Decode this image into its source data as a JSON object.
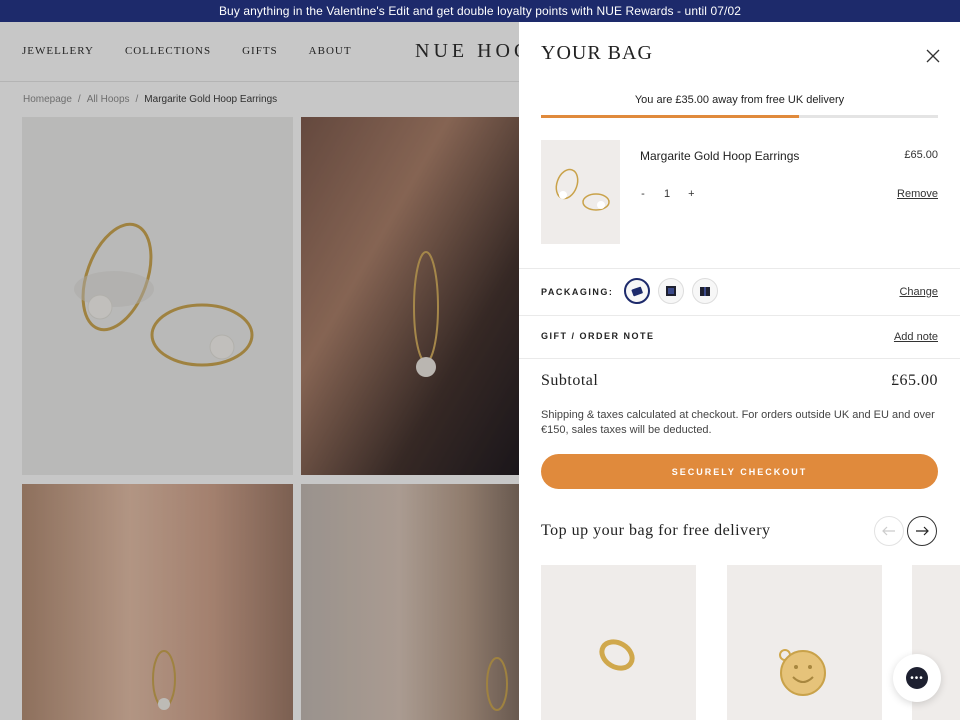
{
  "announcement": "Buy anything in the Valentine's Edit and get double loyalty points with NUE Rewards - until 07/02",
  "header": {
    "nav": [
      "JEWELLERY",
      "COLLECTIONS",
      "GIFTS",
      "ABOUT"
    ],
    "logo": "NUE HOOP"
  },
  "breadcrumb": {
    "home": "Homepage",
    "sep": "/",
    "parent": "All Hoops",
    "current": "Margarite Gold Hoop Earrings"
  },
  "bag": {
    "title": "YOUR BAG",
    "shipping_message": "You are £35.00 away from free UK delivery",
    "progress_fraction": 0.65,
    "item": {
      "name": "Margarite Gold Hoop Earrings",
      "price": "£65.00",
      "qty_minus": "-",
      "qty": "1",
      "qty_plus": "+",
      "remove_label": "Remove"
    },
    "packaging": {
      "label": "PACKAGING:",
      "change_label": "Change"
    },
    "note": {
      "label": "GIFT / ORDER NOTE",
      "add_label": "Add note"
    },
    "subtotal_label": "Subtotal",
    "subtotal_value": "£65.00",
    "shipping_note": "Shipping & taxes calculated at checkout. For orders outside UK and EU and over €150, sales taxes will be deducted.",
    "checkout_label": "SECURELY CHECKOUT",
    "upsell_title": "Top up your bag for free delivery"
  },
  "colors": {
    "announcement_bg": "#1d2a6b",
    "accent": "#e08a3c"
  }
}
